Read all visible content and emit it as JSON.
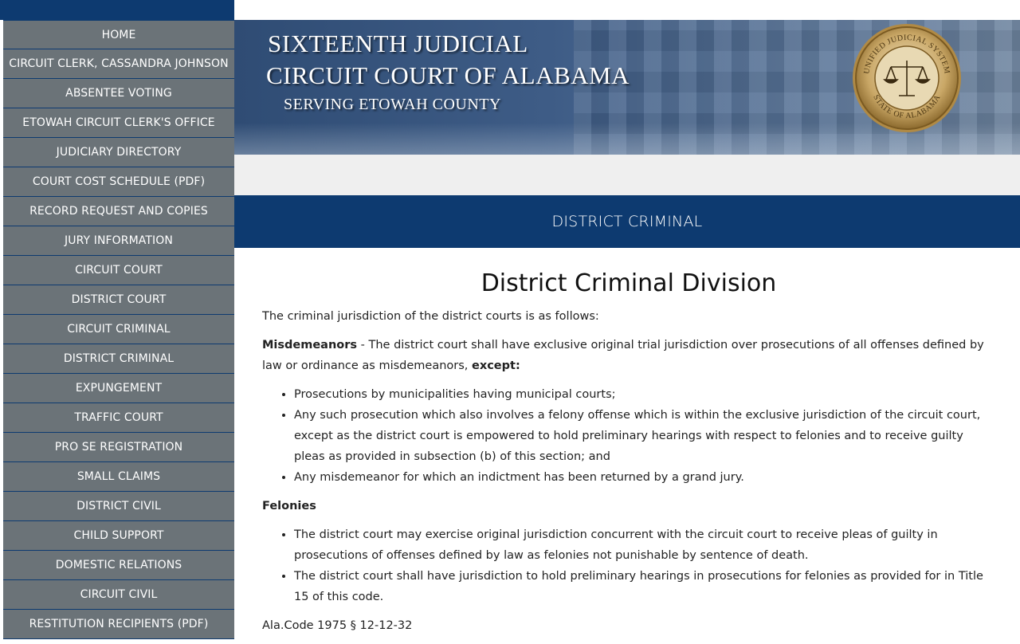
{
  "sidebar": {
    "items": [
      {
        "label": "HOME"
      },
      {
        "label": "CIRCUIT CLERK, CASSANDRA JOHNSON"
      },
      {
        "label": "ABSENTEE VOTING"
      },
      {
        "label": "ETOWAH CIRCUIT CLERK'S OFFICE"
      },
      {
        "label": "JUDICIARY DIRECTORY"
      },
      {
        "label": "COURT COST SCHEDULE (PDF)"
      },
      {
        "label": "RECORD REQUEST AND COPIES"
      },
      {
        "label": "JURY INFORMATION"
      },
      {
        "label": "CIRCUIT COURT"
      },
      {
        "label": "DISTRICT COURT"
      },
      {
        "label": "CIRCUIT CRIMINAL"
      },
      {
        "label": "DISTRICT CRIMINAL"
      },
      {
        "label": "EXPUNGEMENT"
      },
      {
        "label": "TRAFFIC COURT"
      },
      {
        "label": "PRO SE REGISTRATION"
      },
      {
        "label": "SMALL CLAIMS"
      },
      {
        "label": "DISTRICT CIVIL"
      },
      {
        "label": "CHILD SUPPORT"
      },
      {
        "label": "DOMESTIC RELATIONS"
      },
      {
        "label": "CIRCUIT CIVIL"
      },
      {
        "label": "RESTITUTION RECIPIENTS (PDF)"
      }
    ]
  },
  "banner": {
    "line1": "SIXTEENTH JUDICIAL",
    "line2": "CIRCUIT COURT OF ALABAMA",
    "line3": "SERVING ETOWAH COUNTY",
    "seal": {
      "top_text": "UNIFIED JUDICIAL SYSTEM",
      "bottom_text": "STATE OF ALABAMA",
      "icon": "scales-of-justice-icon"
    }
  },
  "section_title": "DISTRICT CRIMINAL",
  "content": {
    "heading": "District Criminal Division",
    "intro": "The criminal jurisdiction of the district courts is as follows:",
    "misdemeanors": {
      "label": "Misdemeanors",
      "text": " - The district court shall have exclusive original trial jurisdiction over prosecutions of all offenses defined by law or ordinance as misdemeanors, ",
      "except": "except:",
      "items": [
        "Prosecutions by municipalities having municipal courts;",
        "Any such prosecution which also involves a felony offense which is within the exclusive jurisdiction of the circuit court, except as the district court is empowered to hold preliminary hearings with respect to felonies and to receive guilty pleas as provided in subsection (b) of this section; and",
        "Any misdemeanor for which an indictment has been returned by a grand jury."
      ]
    },
    "felonies": {
      "label": "Felonies",
      "items": [
        "The district court may exercise original jurisdiction concurrent with the circuit court to receive pleas of guilty in prosecutions of offenses defined by law as felonies not punishable by sentence of death.",
        "The district court shall have jurisdiction to hold preliminary hearings in prosecutions for felonies as provided for in Title 15 of this code."
      ]
    },
    "citation": "Ala.Code 1975 § 12-12-32"
  },
  "colors": {
    "navy": "#0d3a70",
    "sidebar_gray": "#6b7378",
    "strip_gray": "#efefef"
  }
}
